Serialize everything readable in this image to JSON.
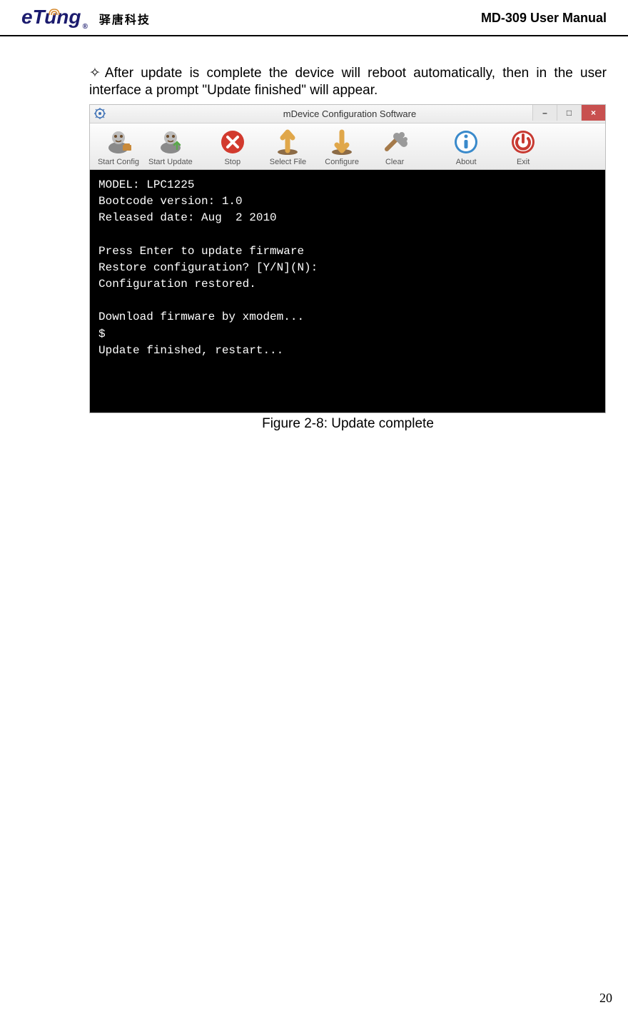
{
  "header": {
    "logo_text": "eTung",
    "logo_cn": "驿唐科技",
    "manual_title": "MD-309 User Manual"
  },
  "body_text": {
    "bullet_marker": "✧",
    "paragraph": "After update is complete the device will reboot automatically, then in the user interface a prompt \"Update finished\" will appear."
  },
  "app": {
    "window_title": "mDevice Configuration Software",
    "window_controls": {
      "minimize": "–",
      "maximize": "□",
      "close": "×"
    },
    "toolbar": [
      {
        "id": "start-config",
        "label": "Start Config"
      },
      {
        "id": "start-update",
        "label": "Start Update"
      },
      {
        "id": "stop",
        "label": "Stop"
      },
      {
        "id": "select-file",
        "label": "Select File"
      },
      {
        "id": "configure",
        "label": "Configure"
      },
      {
        "id": "clear",
        "label": "Clear"
      },
      {
        "id": "about",
        "label": "About"
      },
      {
        "id": "exit",
        "label": "Exit"
      }
    ],
    "console_lines": [
      "MODEL: LPC1225",
      "Bootcode version: 1.0",
      "Released date: Aug  2 2010",
      "",
      "Press Enter to update firmware",
      "Restore configuration? [Y/N](N):",
      "Configuration restored.",
      "",
      "Download firmware by xmodem...",
      "$",
      "Update finished, restart..."
    ]
  },
  "figure_caption": "Figure 2-8: Update complete",
  "page_number": "20"
}
